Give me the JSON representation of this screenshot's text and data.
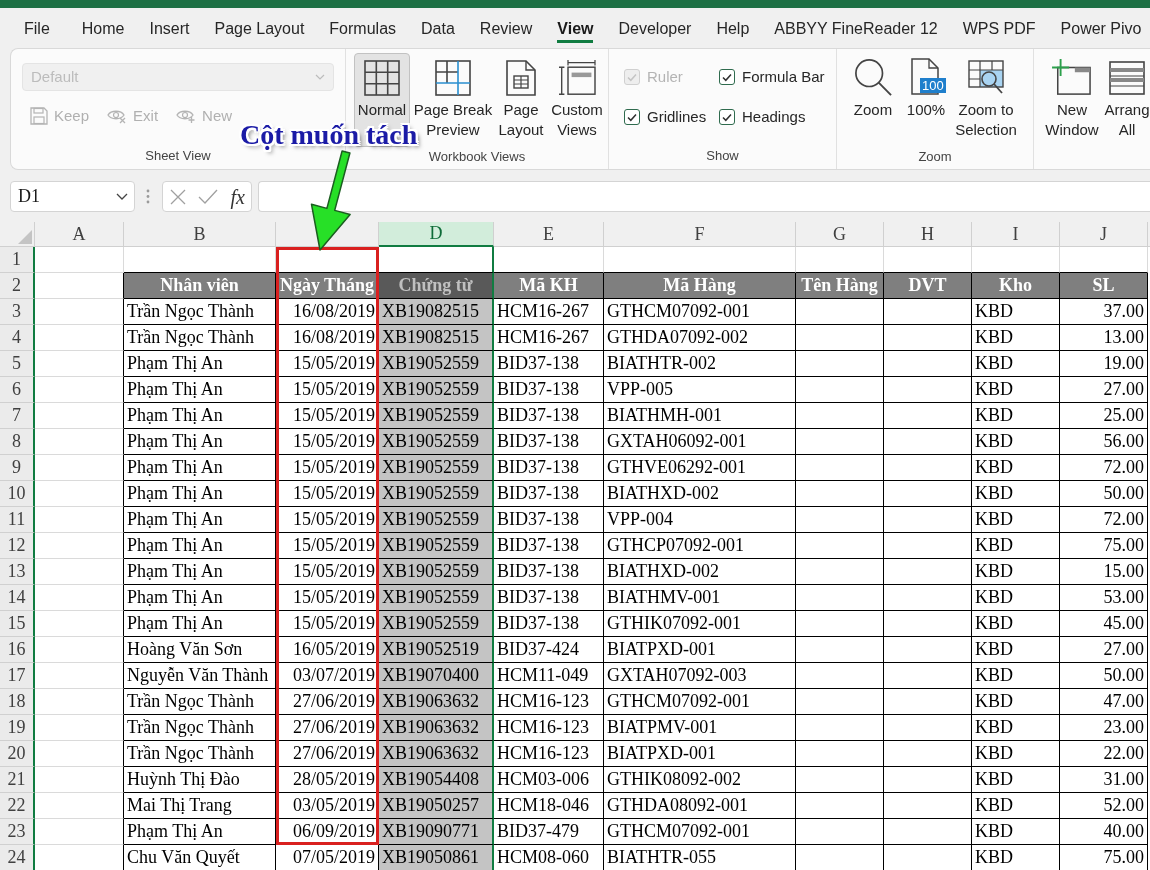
{
  "ribbon_tabs": [
    {
      "label": "File",
      "selected": false
    },
    {
      "label": "Home",
      "selected": false
    },
    {
      "label": "Insert",
      "selected": false
    },
    {
      "label": "Page Layout",
      "selected": false
    },
    {
      "label": "Formulas",
      "selected": false
    },
    {
      "label": "Data",
      "selected": false
    },
    {
      "label": "Review",
      "selected": false
    },
    {
      "label": "View",
      "selected": true
    },
    {
      "label": "Developer",
      "selected": false
    },
    {
      "label": "Help",
      "selected": false
    },
    {
      "label": "ABBYY FineReader 12",
      "selected": false
    },
    {
      "label": "WPS PDF",
      "selected": false
    },
    {
      "label": "Power Pivo",
      "selected": false
    }
  ],
  "ribbon": {
    "groups": [
      {
        "kind": "sheet_view",
        "label": "Sheet View",
        "dropdown": {
          "value": "Default",
          "disabled": true
        },
        "buttons": [
          {
            "label": "Keep",
            "disabled": true
          },
          {
            "label": "Exit",
            "disabled": true
          },
          {
            "label": "New",
            "disabled": true
          }
        ]
      },
      {
        "kind": "large_buttons",
        "label": "Workbook Views",
        "buttons": [
          {
            "label": "Normal",
            "selected": true
          },
          {
            "label": "Page Break Preview",
            "selected": false
          },
          {
            "label": "Page Layout",
            "selected": false
          },
          {
            "label": "Custom Views",
            "selected": false
          }
        ]
      },
      {
        "kind": "checkboxes",
        "label": "Show",
        "items": [
          {
            "label": "Ruler",
            "checked": true,
            "disabled": true
          },
          {
            "label": "Formula Bar",
            "checked": true,
            "disabled": false
          },
          {
            "label": "Gridlines",
            "checked": true,
            "disabled": false
          },
          {
            "label": "Headings",
            "checked": true,
            "disabled": false
          }
        ]
      },
      {
        "kind": "large_buttons",
        "label": "Zoom",
        "buttons": [
          {
            "label": "Zoom"
          },
          {
            "label": "100%",
            "icon_text": "100"
          },
          {
            "label": "Zoom to Selection"
          }
        ]
      },
      {
        "kind": "large_buttons",
        "buttons": [
          {
            "label": "New Window"
          },
          {
            "label": "Arrang All"
          }
        ]
      }
    ]
  },
  "formula_bar": {
    "name_box": "D1",
    "function_label": "fx"
  },
  "sheet": {
    "columns": [
      {
        "letter": "A",
        "selected": false
      },
      {
        "letter": "B",
        "selected": false
      },
      {
        "selected": false
      },
      {
        "letter": "D",
        "selected": true
      },
      {
        "letter": "E",
        "selected": false
      },
      {
        "letter": "F",
        "selected": false
      },
      {
        "letter": "G",
        "selected": false
      },
      {
        "letter": "H",
        "selected": false
      },
      {
        "letter": "I",
        "selected": false
      },
      {
        "letter": "J",
        "selected": false
      }
    ],
    "rows": [
      {
        "number": "1",
        "kind": "blank"
      },
      {
        "number": "2",
        "kind": "header",
        "cells": [
          "Nhân viên",
          "Ngày Tháng",
          "Chứng từ",
          "Mã KH",
          "Mã Hàng",
          "Tên Hàng",
          "DVT",
          "Kho",
          "SL"
        ]
      },
      {
        "number": "3",
        "kind": "data",
        "employee": "Trần Ngọc Thành",
        "date": "16/08/2019",
        "voucher": "XB19082515",
        "customer_code": "HCM16-267",
        "item_code": "GTHCM07092-001",
        "warehouse": "KBD",
        "quantity": "37.00"
      },
      {
        "number": "4",
        "kind": "data",
        "employee": "Trần Ngọc Thành",
        "date": "16/08/2019",
        "voucher": "XB19082515",
        "customer_code": "HCM16-267",
        "item_code": "GTHDA07092-002",
        "warehouse": "KBD",
        "quantity": "13.00"
      },
      {
        "number": "5",
        "kind": "data",
        "employee": "Phạm Thị An",
        "date": "15/05/2019",
        "voucher": "XB19052559",
        "customer_code": "BID37-138",
        "item_code": "BIATHTR-002",
        "warehouse": "KBD",
        "quantity": "19.00"
      },
      {
        "number": "6",
        "kind": "data",
        "employee": "Phạm Thị An",
        "date": "15/05/2019",
        "voucher": "XB19052559",
        "customer_code": "BID37-138",
        "item_code": "VPP-005",
        "warehouse": "KBD",
        "quantity": "27.00"
      },
      {
        "number": "7",
        "kind": "data",
        "employee": "Phạm Thị An",
        "date": "15/05/2019",
        "voucher": "XB19052559",
        "customer_code": "BID37-138",
        "item_code": "BIATHMH-001",
        "warehouse": "KBD",
        "quantity": "25.00"
      },
      {
        "number": "8",
        "kind": "data",
        "employee": "Phạm Thị An",
        "date": "15/05/2019",
        "voucher": "XB19052559",
        "customer_code": "BID37-138",
        "item_code": "GXTAH06092-001",
        "warehouse": "KBD",
        "quantity": "56.00"
      },
      {
        "number": "9",
        "kind": "data",
        "employee": "Phạm Thị An",
        "date": "15/05/2019",
        "voucher": "XB19052559",
        "customer_code": "BID37-138",
        "item_code": "GTHVE06292-001",
        "warehouse": "KBD",
        "quantity": "72.00"
      },
      {
        "number": "10",
        "kind": "data",
        "employee": "Phạm Thị An",
        "date": "15/05/2019",
        "voucher": "XB19052559",
        "customer_code": "BID37-138",
        "item_code": "BIATHXD-002",
        "warehouse": "KBD",
        "quantity": "50.00"
      },
      {
        "number": "11",
        "kind": "data",
        "employee": "Phạm Thị An",
        "date": "15/05/2019",
        "voucher": "XB19052559",
        "customer_code": "BID37-138",
        "item_code": "VPP-004",
        "warehouse": "KBD",
        "quantity": "72.00"
      },
      {
        "number": "12",
        "kind": "data",
        "employee": "Phạm Thị An",
        "date": "15/05/2019",
        "voucher": "XB19052559",
        "customer_code": "BID37-138",
        "item_code": "GTHCP07092-001",
        "warehouse": "KBD",
        "quantity": "75.00"
      },
      {
        "number": "13",
        "kind": "data",
        "employee": "Phạm Thị An",
        "date": "15/05/2019",
        "voucher": "XB19052559",
        "customer_code": "BID37-138",
        "item_code": "BIATHXD-002",
        "warehouse": "KBD",
        "quantity": "15.00"
      },
      {
        "number": "14",
        "kind": "data",
        "employee": "Phạm Thị An",
        "date": "15/05/2019",
        "voucher": "XB19052559",
        "customer_code": "BID37-138",
        "item_code": "BIATHMV-001",
        "warehouse": "KBD",
        "quantity": "53.00"
      },
      {
        "number": "15",
        "kind": "data",
        "employee": "Phạm Thị An",
        "date": "15/05/2019",
        "voucher": "XB19052559",
        "customer_code": "BID37-138",
        "item_code": "GTHIK07092-001",
        "warehouse": "KBD",
        "quantity": "45.00"
      },
      {
        "number": "16",
        "kind": "data",
        "employee": "Hoàng Văn Sơn",
        "date": "16/05/2019",
        "voucher": "XB19052519",
        "customer_code": "BID37-424",
        "item_code": "BIATPXD-001",
        "warehouse": "KBD",
        "quantity": "27.00"
      },
      {
        "number": "17",
        "kind": "data",
        "employee": "Nguyễn Văn Thành",
        "date": "03/07/2019",
        "voucher": "XB19070400",
        "customer_code": "HCM11-049",
        "item_code": "GXTAH07092-003",
        "warehouse": "KBD",
        "quantity": "50.00"
      },
      {
        "number": "18",
        "kind": "data",
        "employee": "Trần Ngọc Thành",
        "date": "27/06/2019",
        "voucher": "XB19063632",
        "customer_code": "HCM16-123",
        "item_code": "GTHCM07092-001",
        "warehouse": "KBD",
        "quantity": "47.00"
      },
      {
        "number": "19",
        "kind": "data",
        "employee": "Trần Ngọc Thành",
        "date": "27/06/2019",
        "voucher": "XB19063632",
        "customer_code": "HCM16-123",
        "item_code": "BIATPMV-001",
        "warehouse": "KBD",
        "quantity": "23.00"
      },
      {
        "number": "20",
        "kind": "data",
        "employee": "Trần Ngọc Thành",
        "date": "27/06/2019",
        "voucher": "XB19063632",
        "customer_code": "HCM16-123",
        "item_code": "BIATPXD-001",
        "warehouse": "KBD",
        "quantity": "22.00"
      },
      {
        "number": "21",
        "kind": "data",
        "employee": "Huỳnh Thị Đào",
        "date": "28/05/2019",
        "voucher": "XB19054408",
        "customer_code": "HCM03-006",
        "item_code": "GTHIK08092-002",
        "warehouse": "KBD",
        "quantity": "31.00"
      },
      {
        "number": "22",
        "kind": "data",
        "employee": "Mai Thị Trang",
        "date": "03/05/2019",
        "voucher": "XB19050257",
        "customer_code": "HCM18-046",
        "item_code": "GTHDA08092-001",
        "warehouse": "KBD",
        "quantity": "52.00"
      },
      {
        "number": "23",
        "kind": "data",
        "employee": "Phạm Thị An",
        "date": "06/09/2019",
        "voucher": "XB19090771",
        "customer_code": "BID37-479",
        "item_code": "GTHCM07092-001",
        "warehouse": "KBD",
        "quantity": "40.00"
      },
      {
        "number": "24",
        "kind": "data",
        "employee": "Chu Văn Quyết",
        "date": "07/05/2019",
        "voucher": "XB19050861",
        "customer_code": "HCM08-060",
        "item_code": "BIATHTR-055",
        "warehouse": "KBD",
        "quantity": "75.00"
      }
    ]
  },
  "annotation": {
    "text": "Cột muốn tách"
  }
}
